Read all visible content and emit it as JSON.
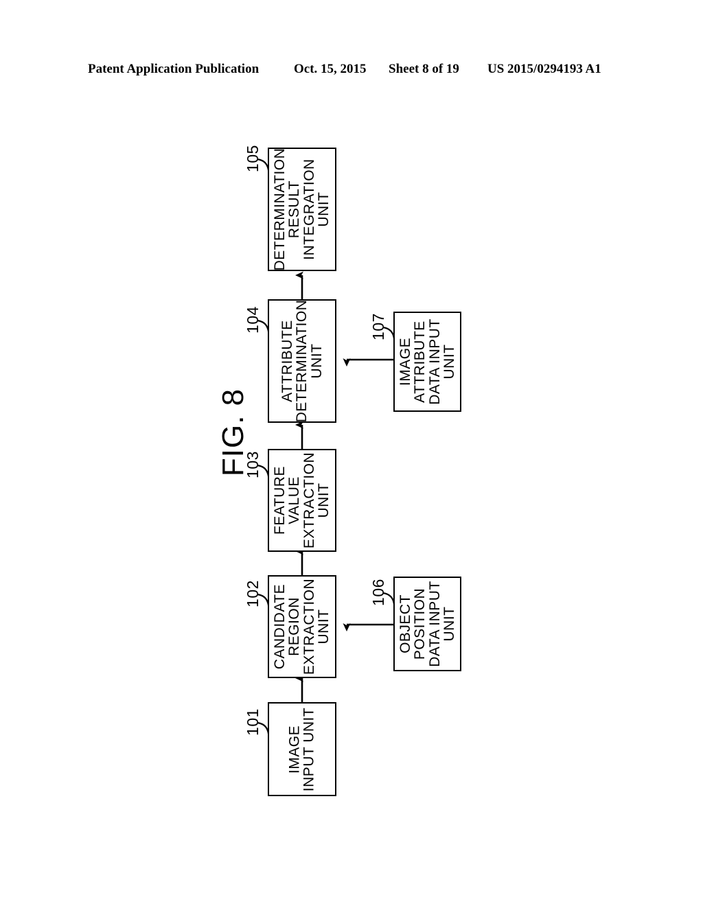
{
  "header": {
    "publication": "Patent Application Publication",
    "date": "Oct. 15, 2015",
    "sheet": "Sheet 8 of 19",
    "patent_number": "US 2015/0294193 A1"
  },
  "figure": {
    "title": "FIG. 8",
    "orientation": "rotated-90-ccw",
    "boxes": [
      {
        "id": "105",
        "ref": "105",
        "label": "DETERMINATION\nRESULT\nINTEGRATION\nUNIT",
        "name": "determination-result-integration-unit"
      },
      {
        "id": "104",
        "ref": "104",
        "label": "ATTRIBUTE\nDETERMINATION\nUNIT",
        "name": "attribute-determination-unit"
      },
      {
        "id": "107",
        "ref": "107",
        "label": "IMAGE\nATTRIBUTE\nDATA INPUT\nUNIT",
        "name": "image-attribute-data-input-unit"
      },
      {
        "id": "103",
        "ref": "103",
        "label": "FEATURE\nVALUE\nEXTRACTION\nUNIT",
        "name": "feature-value-extraction-unit"
      },
      {
        "id": "102",
        "ref": "102",
        "label": "CANDIDATE\nREGION\nEXTRACTION\nUNIT",
        "name": "candidate-region-extraction-unit"
      },
      {
        "id": "106",
        "ref": "106",
        "label": "OBJECT\nPOSITION\nDATA INPUT\nUNIT",
        "name": "object-position-data-input-unit"
      },
      {
        "id": "101",
        "ref": "101",
        "label": "IMAGE\nINPUT UNIT",
        "name": "image-input-unit"
      }
    ],
    "connections": [
      {
        "from": "101",
        "to": "102",
        "kind": "arrow"
      },
      {
        "from": "102",
        "to": "103",
        "kind": "arrow"
      },
      {
        "from": "103",
        "to": "104",
        "kind": "arrow"
      },
      {
        "from": "104",
        "to": "105",
        "kind": "arrow"
      },
      {
        "from": "106",
        "to": "102",
        "kind": "arrow"
      },
      {
        "from": "107",
        "to": "104",
        "kind": "arrow"
      }
    ],
    "colors": {
      "ink": "#000000",
      "background": "#ffffff"
    }
  }
}
